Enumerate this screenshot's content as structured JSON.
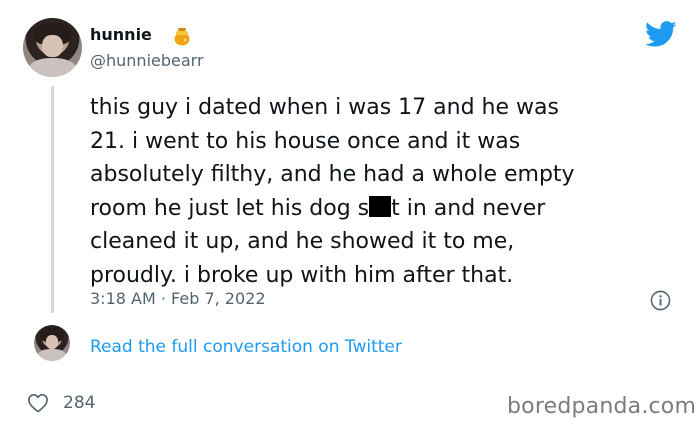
{
  "tweet": {
    "author": {
      "display_name": "hunnie",
      "emoji_icon": "honey-pot-icon",
      "handle": "@hunniebearr"
    },
    "text_before": "this guy i dated when i was 17 and he was\n21. i went to his house once and it was\nabsolutely filthy,  and he had a whole empty\nroom he just let his dog s",
    "redacted_text": "█",
    "text_after": "t in and never\ncleaned it up, and he showed it to me,\nproudly. i broke up with him after that.",
    "timestamp": "3:18 AM · Feb 7, 2022",
    "likes": "284",
    "read_conversation_label": "Read the full conversation on Twitter"
  },
  "brand": {
    "logo": "twitter-bird-icon",
    "logo_color": "#1d9bf0"
  },
  "watermark": "boredpanda.com",
  "colors": {
    "text": "#0f1419",
    "secondary_text": "#536471",
    "link": "#1d9bf0"
  }
}
